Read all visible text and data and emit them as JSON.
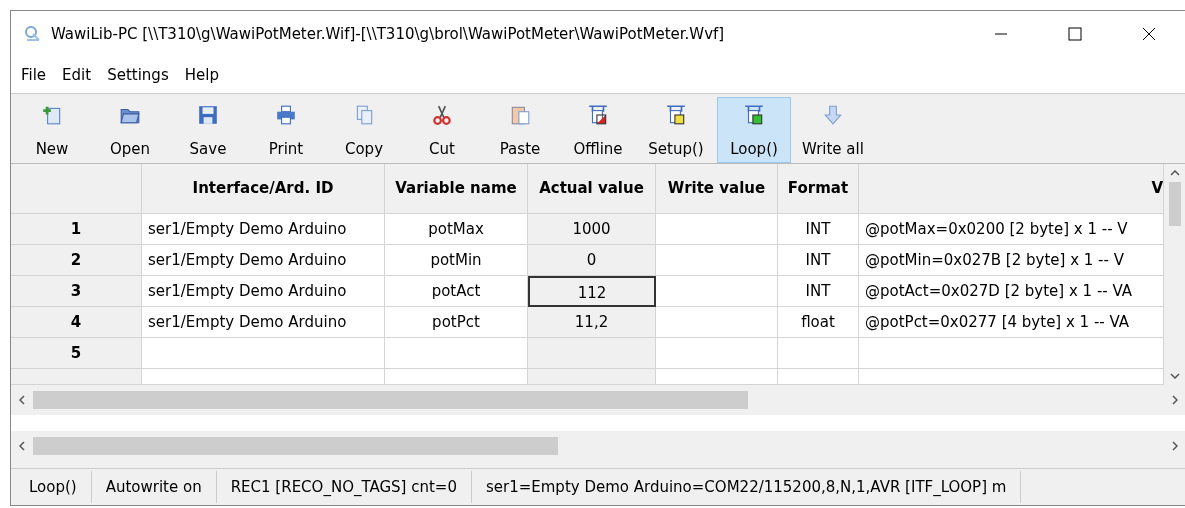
{
  "window": {
    "title": "WawiLib-PC [\\\\T310\\g\\WawiPotMeter.Wif]-[\\\\T310\\g\\brol\\WawiPotMeter\\WawiPotMeter.Wvf]"
  },
  "menu": [
    "File",
    "Edit",
    "Settings",
    "Help"
  ],
  "toolbar": [
    {
      "label": "New",
      "kind": "new",
      "selected": false
    },
    {
      "label": "Open",
      "kind": "open",
      "selected": false
    },
    {
      "label": "Save",
      "kind": "save",
      "selected": false
    },
    {
      "label": "Print",
      "kind": "print",
      "selected": false
    },
    {
      "label": "Copy",
      "kind": "copy",
      "selected": false
    },
    {
      "label": "Cut",
      "kind": "cut",
      "selected": false
    },
    {
      "label": "Paste",
      "kind": "paste",
      "selected": false
    },
    {
      "label": "Offline",
      "kind": "offline",
      "selected": false
    },
    {
      "label": "Setup()",
      "kind": "setup",
      "selected": false
    },
    {
      "label": "Loop()",
      "kind": "loop",
      "selected": true
    },
    {
      "label": "Write all",
      "kind": "write",
      "selected": false
    }
  ],
  "table": {
    "columns": [
      "Interface/Ard. ID",
      "Variable name",
      "Actual value",
      "Write value",
      "Format",
      "V"
    ],
    "rows": [
      {
        "number": "1",
        "cells": [
          "ser1/Empty Demo Arduino",
          "potMax",
          "1000",
          "",
          "INT",
          "@potMax=0x0200 [2 byte] x 1 -- V"
        ],
        "selected": false
      },
      {
        "number": "2",
        "cells": [
          "ser1/Empty Demo Arduino",
          "potMin",
          "0",
          "",
          "INT",
          "@potMin=0x027B [2 byte] x 1 -- V"
        ],
        "selected": false
      },
      {
        "number": "3",
        "cells": [
          "ser1/Empty Demo Arduino",
          "potAct",
          "112",
          "",
          "INT",
          "@potAct=0x027D [2 byte] x 1 -- VA"
        ],
        "selected": true
      },
      {
        "number": "4",
        "cells": [
          "ser1/Empty Demo Arduino",
          "potPct",
          "11,2",
          "",
          "float",
          "@potPct=0x0277 [4 byte] x 1 -- VA"
        ],
        "selected": false
      },
      {
        "number": "5",
        "cells": [
          "",
          "",
          "",
          "",
          "",
          ""
        ],
        "selected": false
      }
    ]
  },
  "status_bar": [
    "Loop()",
    "Autowrite on",
    "REC1 [RECO_NO_TAGS] cnt=0",
    "ser1=Empty Demo Arduino=COM22/115200,8,N,1,AVR [ITF_LOOP] m"
  ]
}
